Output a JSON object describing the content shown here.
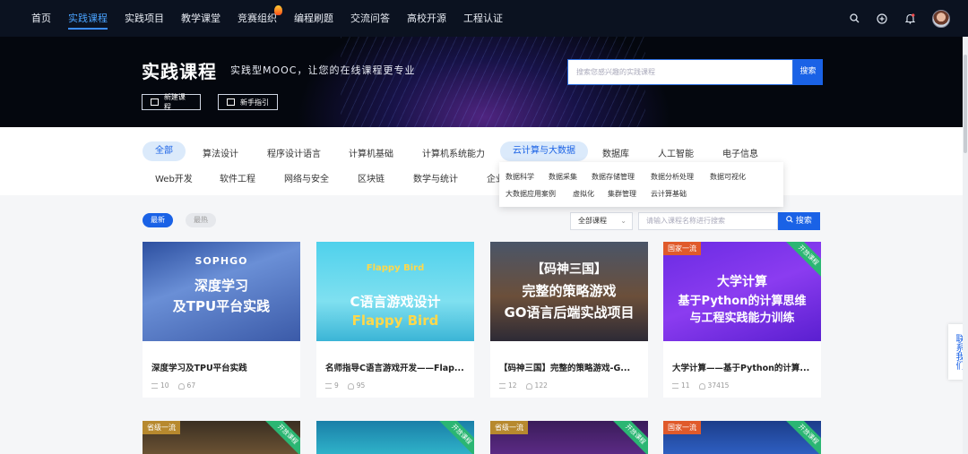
{
  "nav": {
    "items": [
      "首页",
      "实践课程",
      "实践项目",
      "教学课堂",
      "竞赛组织",
      "编程刷题",
      "交流问答",
      "高校开源",
      "工程认证"
    ],
    "active_index": 1,
    "icons": [
      "search-icon",
      "plus-circle-icon",
      "bell-icon",
      "user-avatar"
    ]
  },
  "hero": {
    "title": "实践课程",
    "subtitle": "实践型MOOC，让您的在线课程更专业",
    "new_course": "新建课程",
    "guide": "新手指引",
    "search_placeholder": "搜索您感兴趣的实践课程",
    "search_button": "搜索"
  },
  "categories": {
    "row1": [
      "全部",
      "算法设计",
      "程序设计语言",
      "计算机基础",
      "计算机系统能力",
      "云计算与大数据",
      "数据库",
      "人工智能",
      "电子信息"
    ],
    "row2": [
      "Web开发",
      "软件工程",
      "网络与安全",
      "区块链",
      "数学与统计",
      "企业"
    ],
    "selected": "全部",
    "hovered": "云计算与大数据",
    "dropdown": [
      "数据科学",
      "数据采集",
      "数据存储管理",
      "数据分析处理",
      "数据可视化",
      "大数据应用案例",
      "虚拟化",
      "集群管理",
      "云计算基础"
    ]
  },
  "filters": {
    "tab_latest": "最新",
    "tab_hot": "最热",
    "select_value": "全部课程",
    "search_placeholder": "请输入课程名称进行搜索",
    "search_button": "搜索"
  },
  "cards": [
    {
      "title": "深度学习及TPU平台实践",
      "thumb_lines": [
        "SOPHGO",
        "深度学习",
        "及TPU平台实践"
      ],
      "chapters": "10",
      "learners": "67"
    },
    {
      "title": "名师指导C语言游戏开发——Flap...",
      "thumb_lines": [
        "Flappy Bird",
        "C语言游戏设计",
        "Flappy Bird"
      ],
      "chapters": "9",
      "learners": "95"
    },
    {
      "title": "【码神三国】完整的策略游戏-G...",
      "thumb_lines": [
        "【码神三国】",
        "完整的策略游戏",
        "GO语言后端实战项目"
      ],
      "chapters": "12",
      "learners": "122"
    },
    {
      "title": "大学计算——基于Python的计算...",
      "thumb_lines": [
        "大学计算",
        "基于Python的计算思维",
        "与工程实践能力训练"
      ],
      "badge": "国家一流",
      "ribbon": "开放课程",
      "chapters": "11",
      "learners": "37415"
    }
  ],
  "cards_row2": [
    {
      "badge": "省级一流",
      "ribbon": "开放课程"
    },
    {
      "badge": "",
      "ribbon": "开放课程"
    },
    {
      "badge": "省级一流",
      "ribbon": "开放课程"
    },
    {
      "badge": "国家一流",
      "ribbon": "开放课程"
    }
  ],
  "side_contact": "联系我们"
}
